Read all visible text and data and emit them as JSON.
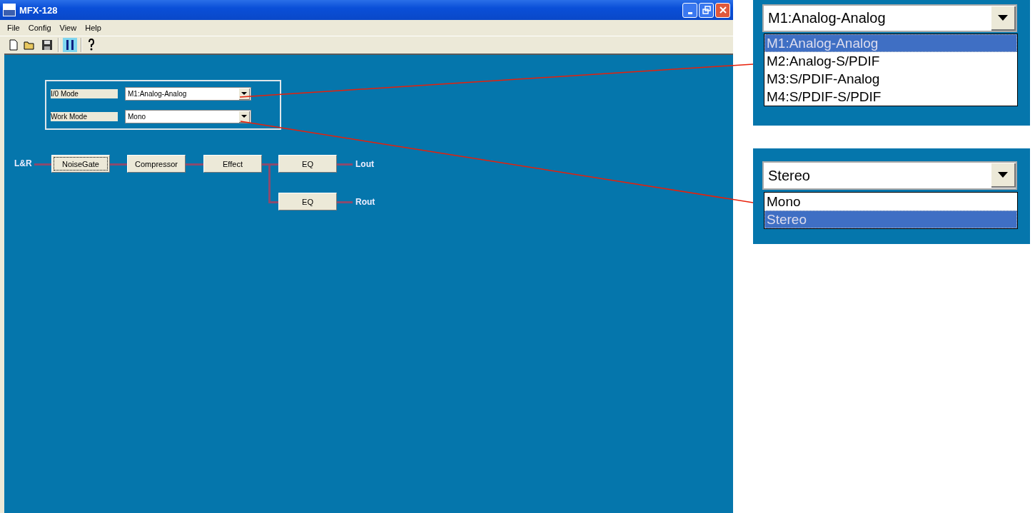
{
  "window": {
    "title": "MFX-128"
  },
  "menu": [
    "File",
    "Config",
    "View",
    "Help"
  ],
  "settings": [
    {
      "label": "I/0 Mode",
      "value": "M1:Analog-Analog"
    },
    {
      "label": "Work Mode",
      "value": "Mono"
    }
  ],
  "chain": {
    "input": "L&R",
    "blocks": [
      {
        "label": "NoiseGate",
        "focused": true
      },
      {
        "label": "Compressor",
        "focused": false
      },
      {
        "label": "Effect",
        "focused": false
      }
    ],
    "outputs": [
      {
        "eq": "EQ",
        "label": "Lout"
      },
      {
        "eq": "EQ",
        "label": "Rout"
      }
    ]
  },
  "callouts": [
    {
      "value": "M1:Analog-Analog",
      "options": [
        {
          "label": "M1:Analog-Analog",
          "selected": true
        },
        {
          "label": "M2:Analog-S/PDIF",
          "selected": false
        },
        {
          "label": "M3:S/PDIF-Analog",
          "selected": false
        },
        {
          "label": "M4:S/PDIF-S/PDIF",
          "selected": false
        }
      ]
    },
    {
      "value": "Stereo",
      "options": [
        {
          "label": "Mono",
          "selected": false
        },
        {
          "label": "Stereo",
          "selected": true
        }
      ]
    }
  ]
}
